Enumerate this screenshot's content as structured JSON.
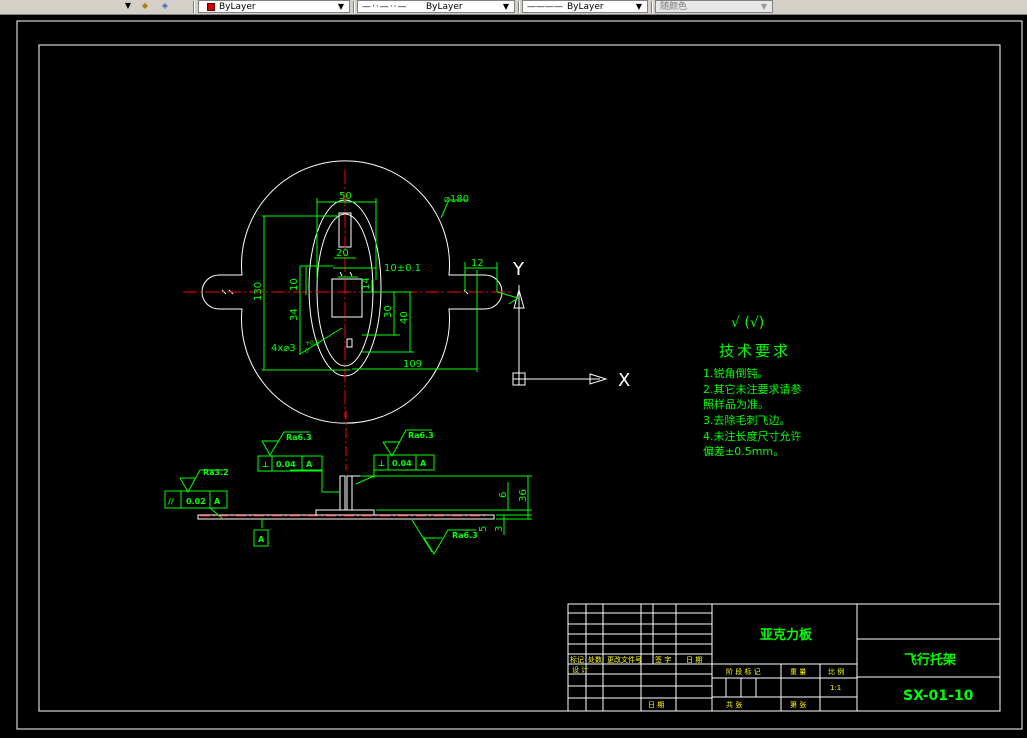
{
  "toolbar": {
    "layer_color_label": "ByLayer",
    "linetype_label": "ByLayer",
    "lineweight_label": "ByLayer",
    "plot_style_label": "随颜色"
  },
  "drawing": {
    "dims": {
      "d50": "50",
      "dia180": "⌀180",
      "d20": "20",
      "d10tol": "10±0.1",
      "d12": "12",
      "d130": "130",
      "d10": "10",
      "d34": "34",
      "d14": "14",
      "d30": "30",
      "d40": "40",
      "d109": "109",
      "d6": "6",
      "d36": "36",
      "d3": "3",
      "d5": "5",
      "holes": "4x⌀3",
      "holes_tol": "+0.5",
      "holes_tol_low": "0"
    },
    "roughness": {
      "r1": "Ra6.3",
      "r2": "Ra6.3",
      "r3": "Ra3.2",
      "r4": "Ra6.3"
    },
    "gdt": {
      "perp1": "⊥",
      "perp1_val": "0.04",
      "perp1_ref": "A",
      "perp2": "⊥",
      "perp2_val": "0.04",
      "perp2_ref": "A",
      "par": "//",
      "par_val": "0.02",
      "par_ref": "A",
      "datum": "A"
    },
    "axes": {
      "y": "Y",
      "x": "X"
    },
    "notes": {
      "symbol": "√ (√)",
      "title": "技术要求",
      "lines": [
        "1.锐角倒钝。",
        "2.其它未注要求请参",
        "照样品为准。",
        "3.去除毛刺飞边。",
        "4.未注长度尺寸允许",
        "偏差±0.5mm。"
      ]
    },
    "title_block": {
      "material": "亚克力板",
      "part_name": "飞行托架",
      "drawing_no": "SX-01-10",
      "h_mark": "标记",
      "h_count": "处数",
      "h_doc": "更改文件号",
      "h_sign": "签 字",
      "h_date": "日 期",
      "h_design": "设 计",
      "h_check": "审 核",
      "h_process": "工 艺",
      "h_stage": "阶 段 标 记",
      "h_weight": "重 量",
      "h_scale": "比 例",
      "scale": "1:1",
      "h_total": "共    张",
      "h_sheet": "第    张",
      "h_dateb": "日 期"
    }
  },
  "colors": {
    "geometry": "#ffffff",
    "dimension": "#00ff00",
    "centerline": "#ff0000",
    "background": "#000000",
    "text_yellow": "#ffff00"
  }
}
